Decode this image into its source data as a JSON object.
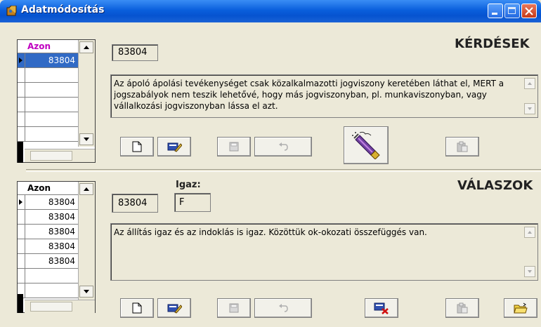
{
  "window": {
    "title": "Adatmódosítás",
    "accent": "#0a5fdc"
  },
  "questions": {
    "section_title": "KÉRDÉSEK",
    "grid_header": "Azon",
    "grid_header_color": "#c000c0",
    "rows": [
      "83804"
    ],
    "id_value": "83804",
    "text": "Az ápoló ápolási tevékenységet csak közalkalmazotti jogviszony keretében láthat el, MERT a jogszabályok nem teszik lehetővé, hogy más jogviszonyban, pl. munkaviszonyban, vagy vállalkozási jogviszonyban lássa el azt.",
    "buttons": [
      "new-icon",
      "edit-icon",
      "save-icon",
      "undo-icon",
      "spray-icon",
      "paste-icon"
    ]
  },
  "answers": {
    "section_title": "VÁLASZOK",
    "grid_header": "Azon",
    "rows": [
      "83804",
      "83804",
      "83804",
      "83804",
      "83804"
    ],
    "id_value": "83804",
    "igaz_label": "Igaz:",
    "igaz_value": "F",
    "text": "Az állítás igaz és az indoklás is igaz. Közöttük ok-okozati összefüggés van.",
    "buttons": [
      "new-icon",
      "edit-icon",
      "save-icon",
      "undo-icon",
      "delete-icon",
      "paste-icon",
      "open-folder-icon"
    ]
  }
}
